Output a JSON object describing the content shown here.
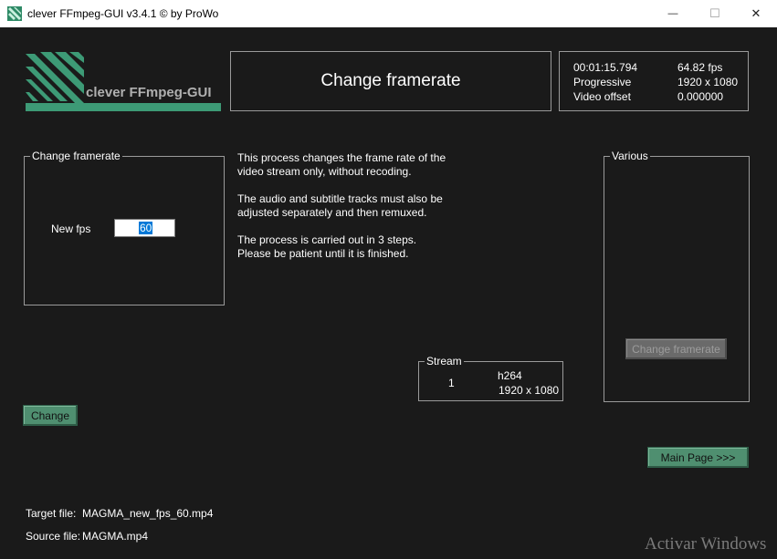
{
  "window": {
    "title": "clever FFmpeg-GUI v3.4.1   © by ProWo",
    "minimize": "—",
    "maximize": "☐",
    "close": "✕"
  },
  "logo": {
    "text": "clever FFmpeg-GUI",
    "color": "#3d9a76"
  },
  "header": {
    "title": "Change framerate"
  },
  "video_info": {
    "duration": "00:01:15.794",
    "fps": "64.82 fps",
    "scan": "Progressive",
    "resolution": "1920 x 1080",
    "offset_label": "Video offset",
    "offset_value": "0.000000"
  },
  "framerate_group": {
    "legend": "Change framerate",
    "new_fps_label": "New fps",
    "new_fps_value": "60"
  },
  "description": {
    "line1": "This process changes the frame rate of the",
    "line2": "video stream only, without recoding.",
    "line3": "The audio and subtitle tracks must also be",
    "line4": "adjusted separately and then remuxed.",
    "line5": "The process is carried out in 3 steps.",
    "line6": "Please be patient until it is finished."
  },
  "various_group": {
    "legend": "Various",
    "button_label": "Change framerate"
  },
  "stream_group": {
    "legend": "Stream",
    "index": "1",
    "codec": "h264",
    "resolution": "1920 x 1080"
  },
  "buttons": {
    "change": "Change",
    "main_page": "Main Page >>>"
  },
  "files": {
    "target_label": "Target file:",
    "target_value": "MAGMA_new_fps_60.mp4",
    "source_label": "Source file:",
    "source_value": "MAGMA.mp4"
  },
  "watermark": "Activar Windows",
  "colors": {
    "accent": "#4f8f70",
    "background": "#1a1a1a"
  }
}
